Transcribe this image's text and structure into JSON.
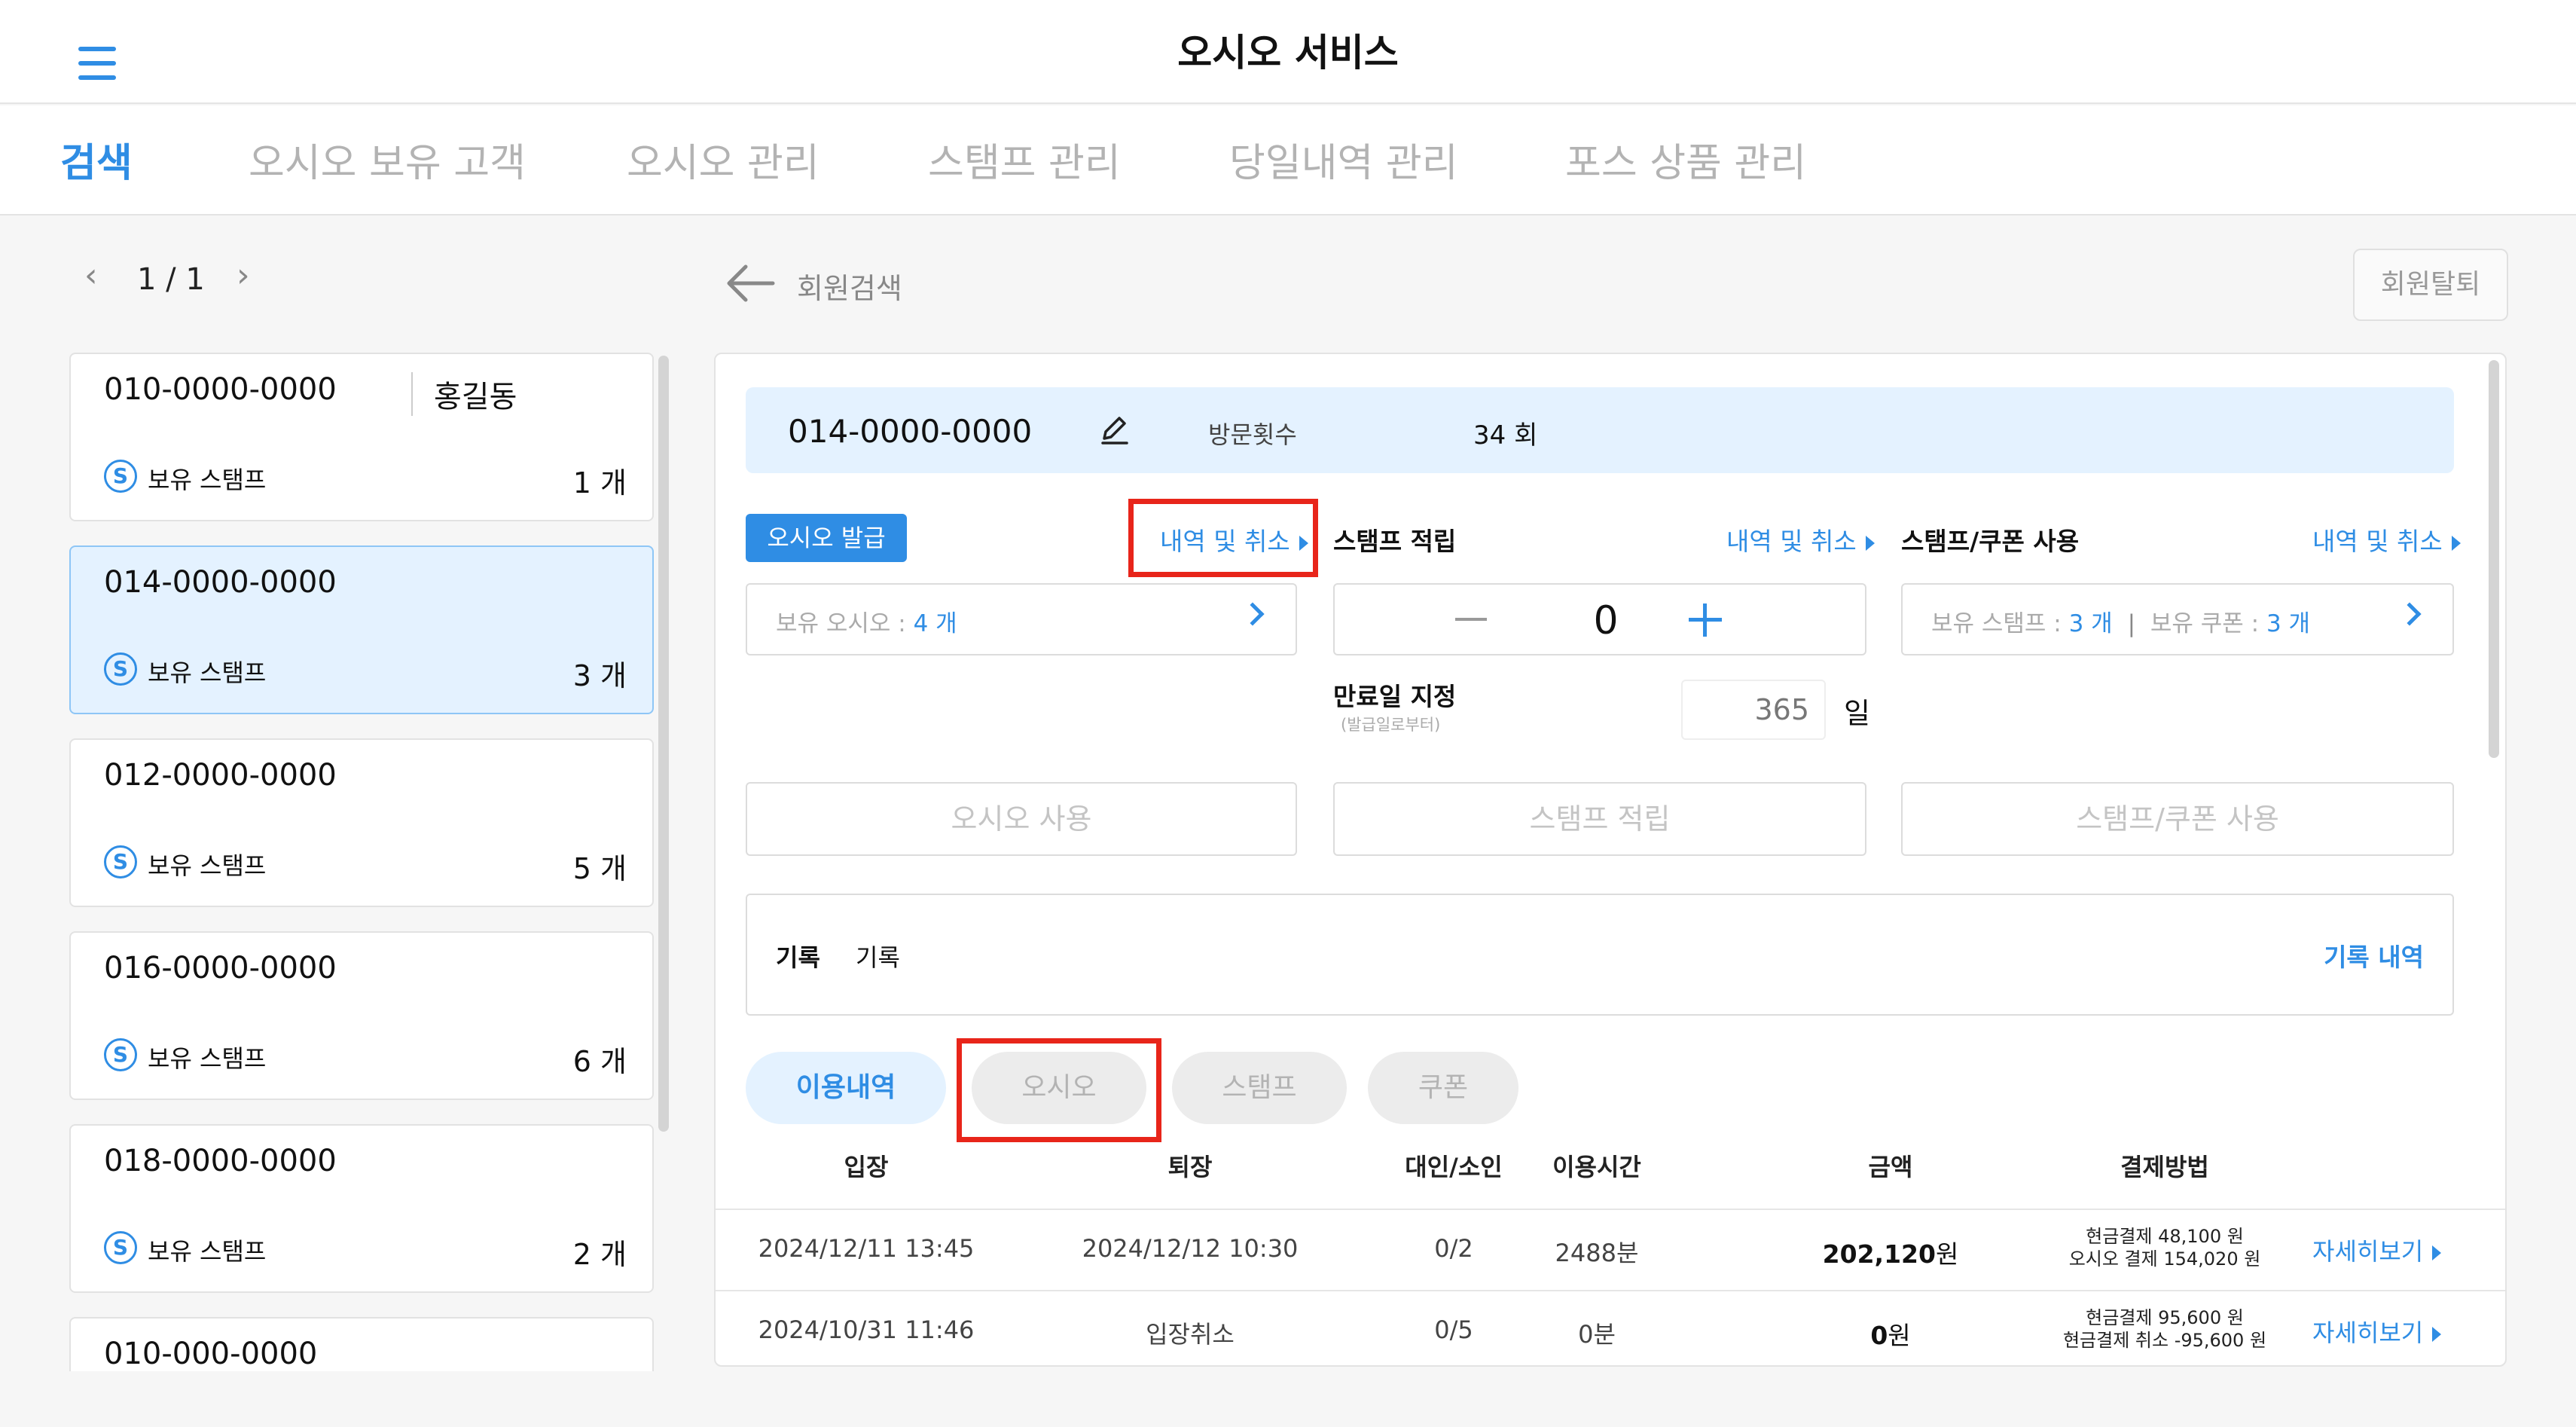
{
  "app": {
    "title": "오시오 서비스"
  },
  "nav": {
    "tabs": [
      {
        "label": "검색",
        "active": true
      },
      {
        "label": "오시오 보유 고객"
      },
      {
        "label": "오시오 관리"
      },
      {
        "label": "스탬프 관리"
      },
      {
        "label": "당일내역 관리"
      },
      {
        "label": "포스 상품 관리"
      }
    ]
  },
  "pager": {
    "text": "1 / 1"
  },
  "members": [
    {
      "phone": "010-0000-0000",
      "name": "홍길동",
      "label": "보유 스탬프",
      "count": "1 개"
    },
    {
      "phone": "014-0000-0000",
      "label": "보유 스탬프",
      "count": "3 개",
      "selected": true
    },
    {
      "phone": "012-0000-0000",
      "label": "보유 스탬프",
      "count": "5 개"
    },
    {
      "phone": "016-0000-0000",
      "label": "보유 스탬프",
      "count": "6 개"
    },
    {
      "phone": "018-0000-0000",
      "label": "보유 스탬프",
      "count": "2 개"
    },
    {
      "phone": "010-000-0000"
    }
  ],
  "member_icon_glyph": "S",
  "header": {
    "back_label": "회원검색",
    "withdraw_label": "회원탈퇴"
  },
  "info": {
    "phone": "014-0000-0000",
    "visit_label": "방문횟수",
    "visit_value": "34 회"
  },
  "osio": {
    "issue_label": "오시오 발급",
    "history_link": "내역 및 취소",
    "held_label": "보유 오시오 : ",
    "held_value": "4 개",
    "use_button": "오시오 사용"
  },
  "stamp": {
    "heading": "스탬프 적립",
    "history_link": "내역 및 취소",
    "stepper_value": "0",
    "expiry_label": "만료일 지정",
    "expiry_sub": "(발급일로부터)",
    "expiry_value": "365",
    "expiry_unit": "일",
    "save_button": "스탬프 적립"
  },
  "coupon": {
    "heading": "스탬프/쿠폰 사용",
    "history_link": "내역 및 취소",
    "stamp_label": "보유 스탬프 : ",
    "stamp_value": "3 개",
    "separator": "|",
    "coupon_label": "보유 쿠폰 : ",
    "coupon_value": "3 개",
    "use_button": "스탬프/쿠폰 사용"
  },
  "record": {
    "label": "기록",
    "value": "기록",
    "link": "기록 내역"
  },
  "filters": [
    {
      "label": "이용내역",
      "active": true
    },
    {
      "label": "오시오"
    },
    {
      "label": "스탬프"
    },
    {
      "label": "쿠폰"
    }
  ],
  "table": {
    "headers": [
      "입장",
      "퇴장",
      "대인/소인",
      "이용시간",
      "금액",
      "결제방법"
    ],
    "rows": [
      {
        "entry": "2024/12/11 13:45",
        "exit": "2024/12/12 10:30",
        "people": "0/2",
        "duration": "2488분",
        "amount": "202,120",
        "unit": "원",
        "pay1": "현금결제 48,100 원",
        "pay2": "오시오 결제 154,020 원",
        "detail": "자세히보기"
      },
      {
        "entry": "2024/10/31 11:46",
        "exit": "입장취소",
        "people": "0/5",
        "duration": "0분",
        "amount": "0",
        "unit": "원",
        "pay1": "현금결제 95,600 원",
        "pay2": "현금결제 취소 -95,600 원",
        "detail": "자세히보기"
      }
    ]
  }
}
